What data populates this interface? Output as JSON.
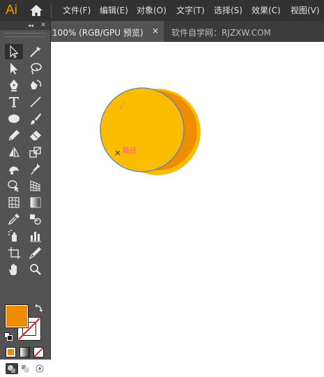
{
  "app": {
    "logo_text": "Ai"
  },
  "menu": {
    "items": [
      {
        "id": "file",
        "label": "文件(F)"
      },
      {
        "id": "edit",
        "label": "编辑(E)"
      },
      {
        "id": "object",
        "label": "对象(O)"
      },
      {
        "id": "type",
        "label": "文字(T)"
      },
      {
        "id": "select",
        "label": "选择(S)"
      },
      {
        "id": "effect",
        "label": "效果(C)"
      },
      {
        "id": "view",
        "label": "视图(V)"
      }
    ]
  },
  "toolbar": {
    "collapse_glyph": "◂◂",
    "close_glyph": "×",
    "tools": [
      {
        "icon": "selection-tool-icon"
      },
      {
        "icon": "magic-wand-tool-icon"
      },
      {
        "icon": "direct-selection-tool-icon"
      },
      {
        "icon": "lasso-tool-icon"
      },
      {
        "icon": "pen-tool-icon"
      },
      {
        "icon": "curvature-tool-icon"
      },
      {
        "icon": "type-tool-icon"
      },
      {
        "icon": "line-segment-tool-icon"
      },
      {
        "icon": "ellipse-tool-icon"
      },
      {
        "icon": "paintbrush-tool-icon"
      },
      {
        "icon": "pencil-tool-icon"
      },
      {
        "icon": "eraser-tool-icon"
      },
      {
        "icon": "reflect-tool-icon"
      },
      {
        "icon": "scale-tool-icon"
      },
      {
        "icon": "warp-tool-icon"
      },
      {
        "icon": "puppet-warp-tool-icon"
      },
      {
        "icon": "shape-builder-tool-icon"
      },
      {
        "icon": "perspective-grid-tool-icon"
      },
      {
        "icon": "mesh-tool-icon"
      },
      {
        "icon": "gradient-tool-icon"
      },
      {
        "icon": "eyedropper-tool-icon"
      },
      {
        "icon": "blend-tool-icon"
      },
      {
        "icon": "symbol-sprayer-tool-icon"
      },
      {
        "icon": "column-graph-tool-icon"
      },
      {
        "icon": "artboard-tool-icon"
      },
      {
        "icon": "slice-tool-icon"
      },
      {
        "icon": "hand-tool-icon"
      },
      {
        "icon": "zoom-tool-icon"
      }
    ],
    "fill_color": "#f08c00",
    "stroke_color": "none"
  },
  "tabs": {
    "active": {
      "label": "100% (RGB/GPU 预览)",
      "close_glyph": "×"
    },
    "inactive": {
      "label": "软件自学网：RJZXW.COM"
    }
  },
  "canvas": {
    "path_hint": "路径",
    "colors": {
      "back_circle": "#fcbc00",
      "crescent": "#f08c00",
      "front_circle": "#fcbc00",
      "selection_outline": "#4a86c8",
      "hint": "#ff4fa3"
    }
  }
}
